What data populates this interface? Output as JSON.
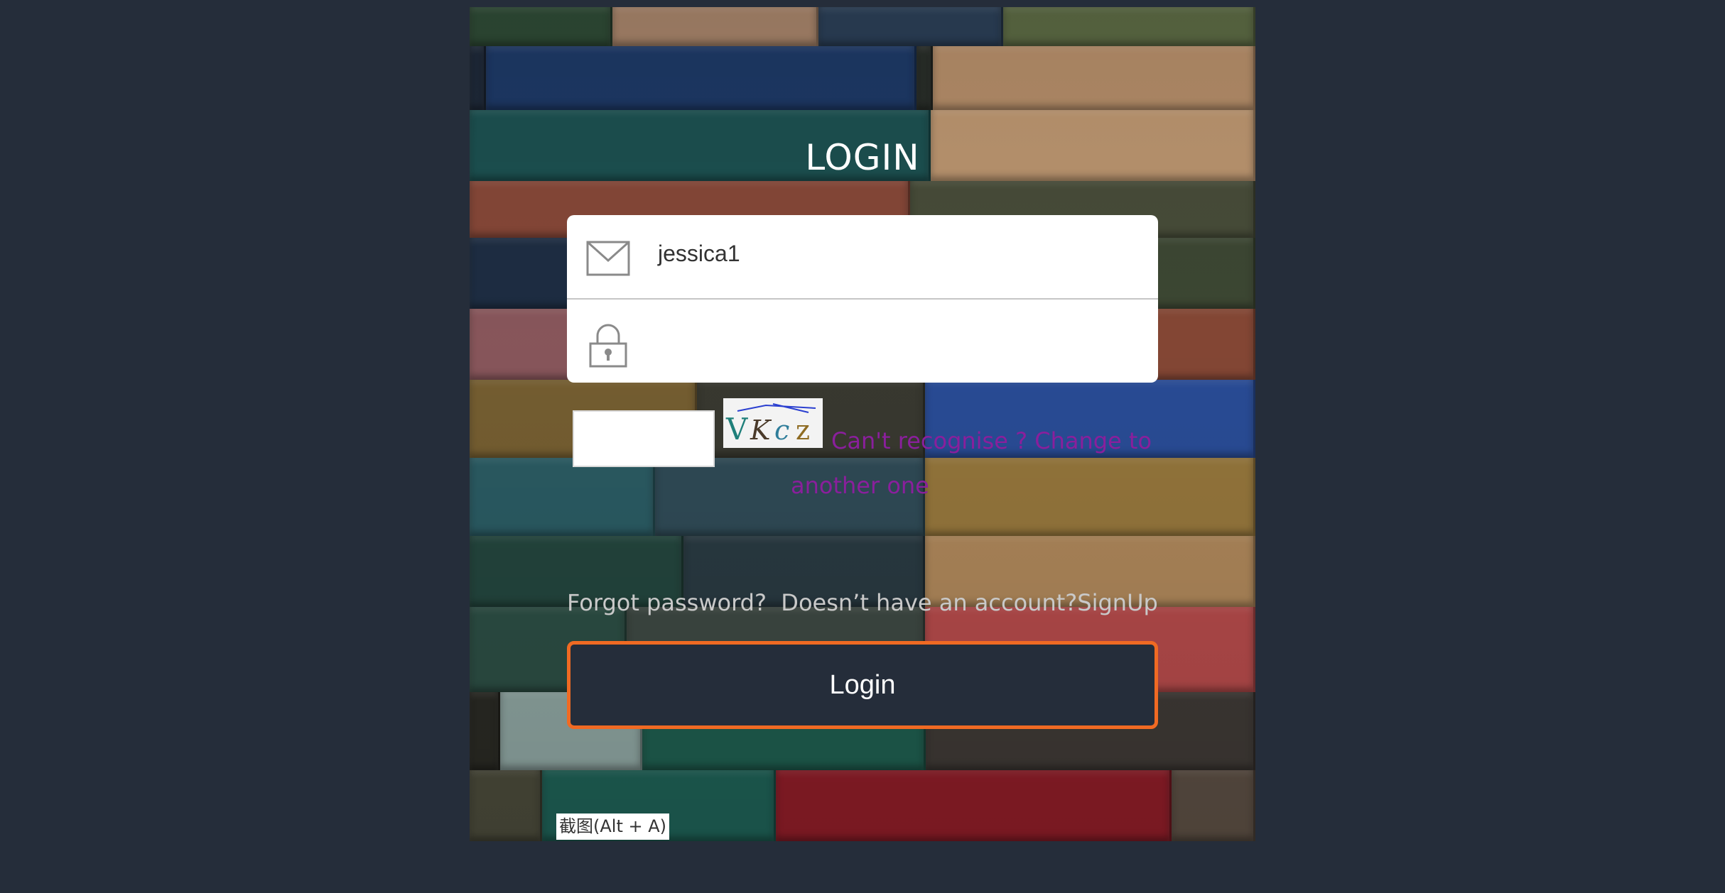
{
  "login_panel": {
    "title": "LOGIN",
    "username": {
      "value": "jessica1",
      "icon": "envelope-icon"
    },
    "password": {
      "value": "",
      "icon": "padlock-icon"
    },
    "captcha": {
      "input_value": "",
      "image_text": "VKcz",
      "change_link": "Can't recognise ? Change to another one"
    },
    "forgot_password": "Forgot password?",
    "no_account_text": "Doesn’t have an account?",
    "signup_link": "SignUp",
    "login_button": "Login",
    "colors": {
      "page_background": "#252d3a",
      "button_border": "#f06a23",
      "link_purple": "#8a1f9c",
      "helper_text": "#c9c9c9"
    }
  },
  "tooltip": {
    "text": "截图(Alt + A)"
  }
}
